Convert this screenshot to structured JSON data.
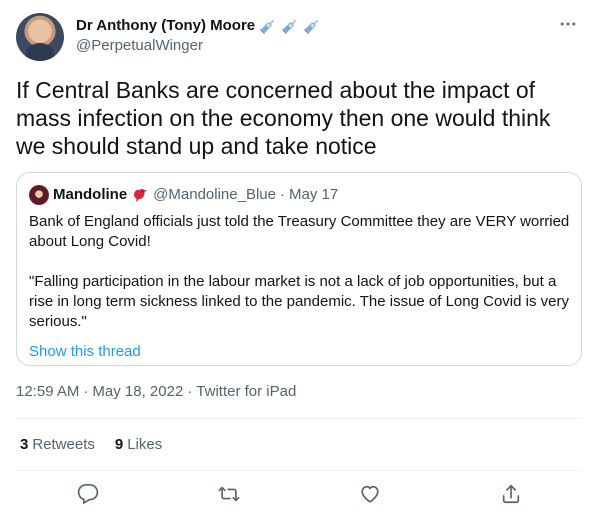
{
  "author": {
    "display_name": "Dr Anthony (Tony) Moore",
    "emoji": [
      "syringe-icon",
      "syringe-icon",
      "syringe-icon"
    ],
    "handle": "@PerpetualWinger"
  },
  "tweet": {
    "text": "If Central Banks are concerned about the impact of mass infection on the economy then one would think we should stand up and take notice"
  },
  "quote": {
    "display_name": "Mandoline",
    "emoji": "bird-icon",
    "handle": "@Mandoline_Blue",
    "separator": "·",
    "date": "May 17",
    "paragraph1": "Bank of England officials just told the Treasury Committee they are VERY worried about Long Covid!",
    "paragraph2": "\"Falling participation in the labour market is not a lack of job opportunities, but a rise in long term sickness linked to the pandemic. The issue of Long Covid is very serious.\"",
    "show_thread": "Show this thread"
  },
  "meta": {
    "time": "12:59 AM",
    "dot": "·",
    "date": "May 18, 2022",
    "source": "Twitter for iPad"
  },
  "stats": {
    "retweets_count": "3",
    "retweets_label": "Retweets",
    "likes_count": "9",
    "likes_label": "Likes"
  },
  "actions": [
    "reply-icon",
    "retweet-icon",
    "like-icon",
    "share-icon"
  ],
  "colors": {
    "link": "#1d9bf0",
    "secondary_text": "#536471",
    "border": "#cfd9de"
  }
}
